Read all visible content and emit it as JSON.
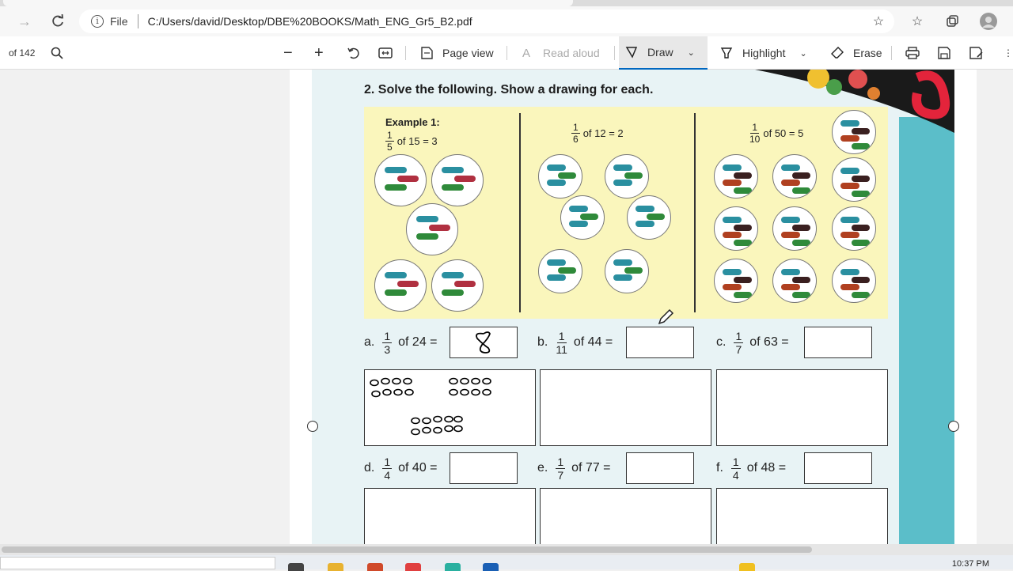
{
  "browser": {
    "file_label": "File",
    "url": "C:/Users/david/Desktop/DBE%20BOOKS/Math_ENG_Gr5_B2.pdf"
  },
  "pdf_toolbar": {
    "page_count": "of 142",
    "page_view": "Page view",
    "read_aloud": "Read aloud",
    "draw": "Draw",
    "highlight": "Highlight",
    "erase": "Erase"
  },
  "worksheet": {
    "question": "2. Solve the following. Show a drawing for each.",
    "examples": [
      {
        "heading": "Example 1:",
        "num": "1",
        "den": "5",
        "rest": "of 15 = 3"
      },
      {
        "heading": "",
        "num": "1",
        "den": "6",
        "rest": "of 12 = 2"
      },
      {
        "heading": "",
        "num": "1",
        "den": "10",
        "rest": "of 50 = 5"
      }
    ],
    "problems": [
      {
        "letter": "a.",
        "num": "1",
        "den": "3",
        "rest": "of 24 =",
        "answer": "8"
      },
      {
        "letter": "b.",
        "num": "1",
        "den": "11",
        "rest": "of 44 =",
        "answer": ""
      },
      {
        "letter": "c.",
        "num": "1",
        "den": "7",
        "rest": "of 63 =",
        "answer": ""
      },
      {
        "letter": "d.",
        "num": "1",
        "den": "4",
        "rest": "of 40 =",
        "answer": ""
      },
      {
        "letter": "e.",
        "num": "1",
        "den": "7",
        "rest": "of 77 =",
        "answer": ""
      },
      {
        "letter": "f.",
        "num": "1",
        "den": "4",
        "rest": "of 48 =",
        "answer": ""
      }
    ]
  },
  "taskbar": {
    "clock": "10:37 PM"
  },
  "colors": {
    "worksheet_bg": "#e8f3f5",
    "example_panel": "#faf6bc",
    "teal_band": "#5bbec9",
    "accent": "#0067c0"
  }
}
